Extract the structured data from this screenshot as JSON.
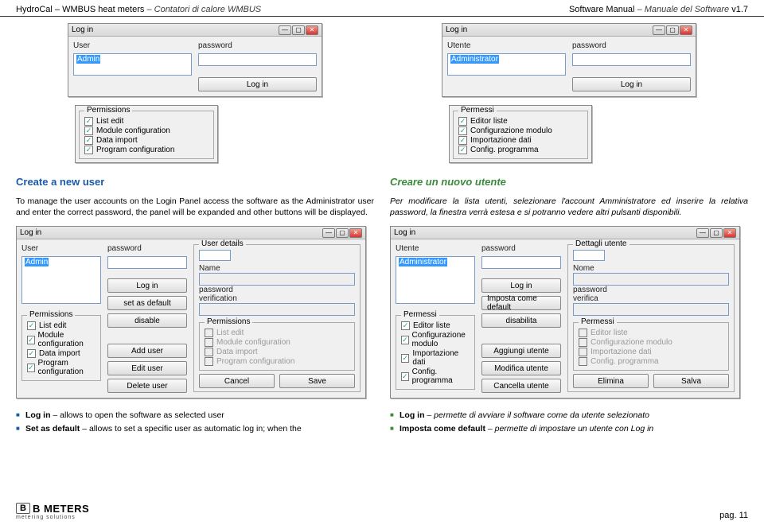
{
  "header": {
    "product": "HydroCal – WMBUS heat meters",
    "product_it": "– Contatori di calore WMBUS",
    "manual": "Software Manual",
    "manual_it": "– Manuale del Software",
    "version": "v1.7"
  },
  "win_en_simple": {
    "title": "Log in",
    "user_label": "User",
    "user_value": "Admin",
    "pwd_label": "password",
    "login_btn": "Log in"
  },
  "win_it_simple": {
    "title": "Log in",
    "user_label": "Utente",
    "user_value": "Administrator",
    "pwd_label": "password",
    "login_btn": "Log in"
  },
  "perm_en": {
    "title": "Permissions",
    "items": [
      "List edit",
      "Module configuration",
      "Data import",
      "Program configuration"
    ]
  },
  "perm_it": {
    "title": "Permessi",
    "items": [
      "Editor liste",
      "Configurazione modulo",
      "Importazione dati",
      "Config. programma"
    ]
  },
  "text_en": {
    "heading": "Create a new user",
    "body": "To manage the user accounts on the Login Panel access the software as the Administrator user and enter the correct password, the panel will be expanded and other buttons will be displayed."
  },
  "text_it": {
    "heading": "Creare un nuovo utente",
    "body": "Per modificare la lista utenti, selezionare l'account Amministratore ed inserire la relativa password, la finestra verrà estesa e si potranno vedere altri pulsanti disponibili."
  },
  "win_en_ext": {
    "title": "Log in",
    "user_label": "User",
    "user_value": "Admin",
    "pwd_label": "password",
    "login_btn": "Log in",
    "set_default": "set as default",
    "disable": "disable",
    "add_user": "Add user",
    "edit_user": "Edit user",
    "delete_user": "Delete user",
    "details_title": "User details",
    "name_label": "Name",
    "pwd2_label": "password",
    "verify_label": "verification",
    "perm_title": "Permissions",
    "perm_items": [
      "List edit",
      "Module configuration",
      "Data import",
      "Program configuration"
    ],
    "cancel": "Cancel",
    "save": "Save"
  },
  "win_it_ext": {
    "title": "Log in",
    "user_label": "Utente",
    "user_value": "Administrator",
    "pwd_label": "password",
    "login_btn": "Log in",
    "set_default": "Imposta come default",
    "disable": "disabilita",
    "add_user": "Aggiungi utente",
    "edit_user": "Modifica utente",
    "delete_user": "Cancella utente",
    "details_title": "Dettagli utente",
    "name_label": "Nome",
    "pwd2_label": "password",
    "verify_label": "verifica",
    "perm_title": "Permessi",
    "perm_items": [
      "Editor liste",
      "Configurazione modulo",
      "Importazione dati",
      "Config. programma"
    ],
    "cancel": "Elimina",
    "save": "Salva"
  },
  "bullets_en": {
    "login_bold": "Log in",
    "login_rest": " – allows to open the software as selected user",
    "set_bold": "Set as default",
    "set_rest": " – allows to set a specific user as automatic log in; when the"
  },
  "bullets_it": {
    "login_bold": "Log in",
    "login_rest": " – permette di avviare il software come da utente selezionato",
    "set_bold": "Imposta come default",
    "set_rest": "  – permette di impostare un utente con Log in"
  },
  "footer": {
    "brand": "B METERS",
    "sub": "metering solutions",
    "page": "pag. 11"
  }
}
